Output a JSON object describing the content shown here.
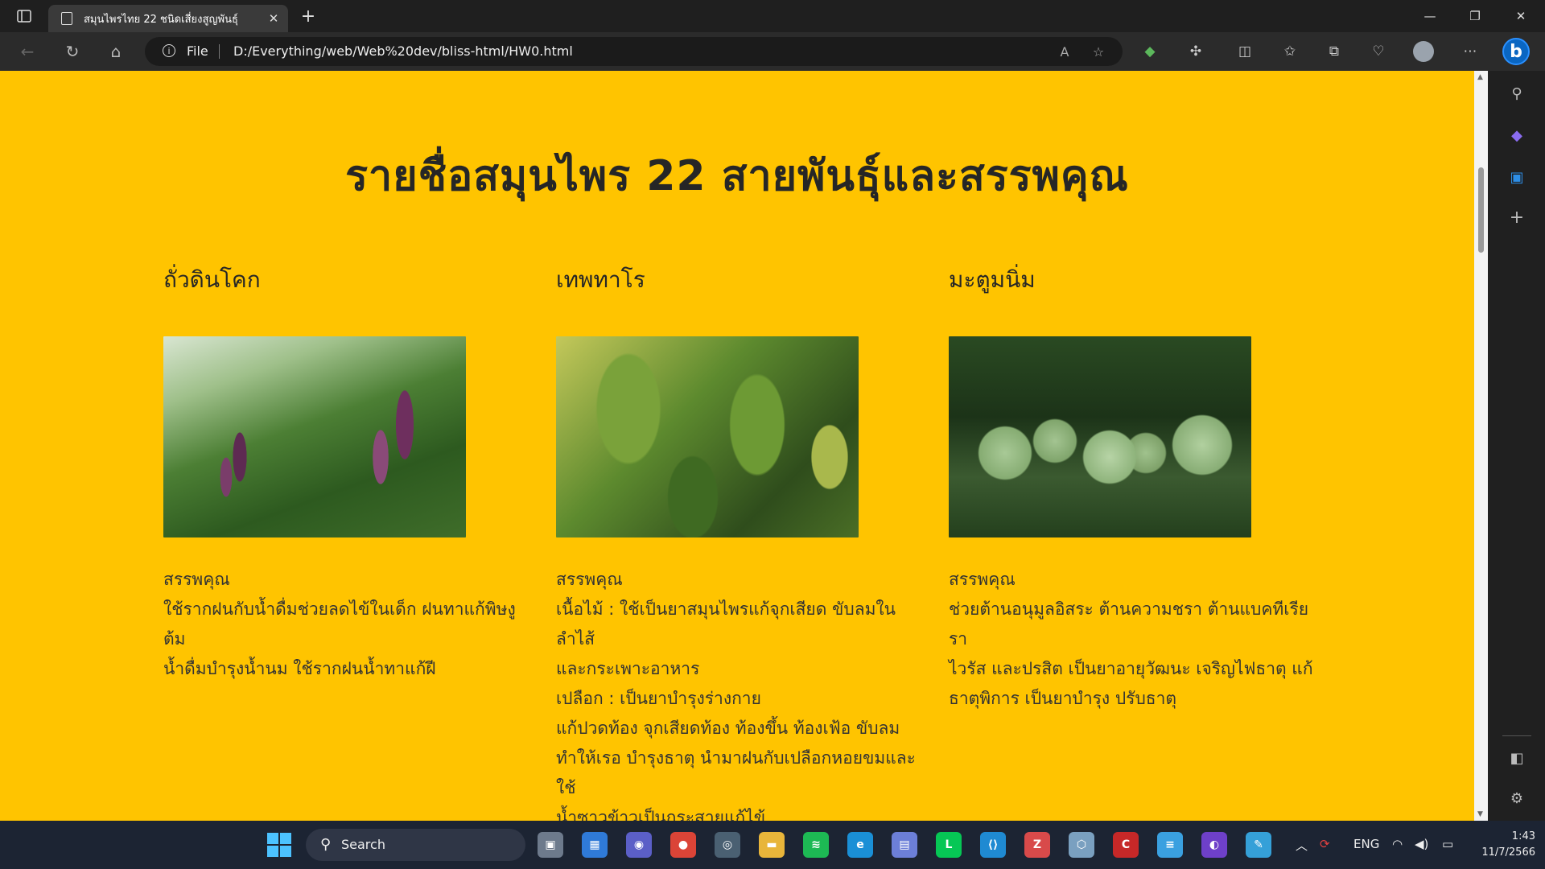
{
  "browser": {
    "tab_title": "สมุนไพรไทย 22 ชนิดเสี่ยงสูญพันธุ์",
    "tab_close": "✕",
    "new_tab": "+",
    "address_prefix": "File",
    "url": "D:/Everything/web/Web%20dev/bliss-html/HW0.html",
    "window_controls": {
      "minimize": "—",
      "restore": "❐",
      "close": "✕"
    },
    "colors": {
      "tab_bar": "#1f1f1f",
      "toolbar": "#2b2b2b",
      "sidebar": "#202020",
      "bing": "#0a66c2"
    },
    "toolbar_icons": [
      "back-icon",
      "refresh-icon",
      "home-icon",
      "read-aloud-icon",
      "favorite-star-icon",
      "extension-icon",
      "puzzle-icon",
      "split-screen-icon",
      "favorites-icon",
      "collections-icon",
      "health-icon",
      "profile-icon",
      "more-icon",
      "bing-icon"
    ],
    "sidebar_icons": [
      "search-icon",
      "copilot-icon",
      "outlook-icon",
      "add-icon",
      "panel-icon",
      "settings-icon"
    ]
  },
  "page": {
    "background": "#ffc400",
    "title": "รายชื่อสมุนไพร 22 สายพันธุ์และสรรพคุณ",
    "herbs": [
      {
        "name": "ถั่วดินโคก",
        "image_colors": [
          "#3a6e2c",
          "#7a3d6a",
          "#c8d8c0"
        ],
        "benefit_label": "สรรพคุณ",
        "benefit_text": "ใช้รากฝนกับน้ำดื่มช่วยลดไข้ในเด็ก ฝนทาแก้พิษงู ต้ม\nน้ำดื่มบำรุงน้ำนม ใช้รากฝนน้ำทาแก้ฝี"
      },
      {
        "name": "เทพทาโร",
        "image_colors": [
          "#5d8a2e",
          "#a7b94a",
          "#2f4d1c"
        ],
        "benefit_label": "สรรพคุณ",
        "benefit_text": "เนื้อไม้ : ใช้เป็นยาสมุนไพรแก้จุกเสียด ขับลมในลำไส้\nและกระเพาะอาหาร\nเปลือก : เป็นยาบำรุงร่างกาย\nแก้ปวดท้อง จุกเสียดท้อง ท้องขึ้น ท้องเฟ้อ ขับลม\nทำให้เรอ บำรุงธาตุ นำมาฝนกับเปลือกหอยขมและใช้\nน้ำซาวข้าวเป็นกระสายแก้ไข้"
      },
      {
        "name": "มะตูมนิ่ม",
        "image_colors": [
          "#1f3a1a",
          "#9cbf86",
          "#4a6b3a"
        ],
        "benefit_label": "สรรพคุณ",
        "benefit_text": "ช่วยต้านอนุมูลอิสระ ต้านความชรา ต้านแบคทีเรีย รา\nไวรัส และปรสิต เป็นยาอายุวัฒนะ เจริญไฟธาตุ แก้\nธาตุพิการ เป็นยาบำรุง ปรับธาตุ"
      }
    ]
  },
  "taskbar": {
    "search_label": "Search",
    "language": "ENG",
    "time": "1:43",
    "date": "11/7/2566",
    "colors": {
      "background": "#1c2433",
      "start": "#4cc2ff"
    },
    "apps": [
      {
        "name": "task-view-icon",
        "color": "#6d7a8c",
        "glyph": "▣"
      },
      {
        "name": "widgets-icon",
        "color": "#2f7ad8",
        "glyph": "▦"
      },
      {
        "name": "teams-chat-icon",
        "color": "#5b5fc7",
        "glyph": "◉"
      },
      {
        "name": "chrome-icon",
        "color": "#db4437",
        "glyph": "●"
      },
      {
        "name": "app-circle-icon",
        "color": "#4a6072",
        "glyph": "◎"
      },
      {
        "name": "file-explorer-icon",
        "color": "#e8b53a",
        "glyph": "▬"
      },
      {
        "name": "spotify-icon",
        "color": "#1db954",
        "glyph": "≋"
      },
      {
        "name": "edge-icon",
        "color": "#1a8fd6",
        "glyph": "e"
      },
      {
        "name": "photo-app-icon",
        "color": "#6c7fd8",
        "glyph": "▤"
      },
      {
        "name": "line-icon",
        "color": "#06c755",
        "glyph": "L"
      },
      {
        "name": "vscode-icon",
        "color": "#1f8ad2",
        "glyph": "⟨⟩"
      },
      {
        "name": "sketch-app-icon",
        "color": "#d84a4a",
        "glyph": "Z"
      },
      {
        "name": "box-app-icon",
        "color": "#7aa0c0",
        "glyph": "⬡"
      },
      {
        "name": "devcpp-icon",
        "color": "#c62828",
        "glyph": "C"
      },
      {
        "name": "notepad-icon",
        "color": "#3aa0e0",
        "glyph": "≡"
      },
      {
        "name": "github-icon",
        "color": "#6e40c9",
        "glyph": "◐"
      },
      {
        "name": "paint-icon",
        "color": "#35a0d8",
        "glyph": "✎"
      }
    ]
  }
}
